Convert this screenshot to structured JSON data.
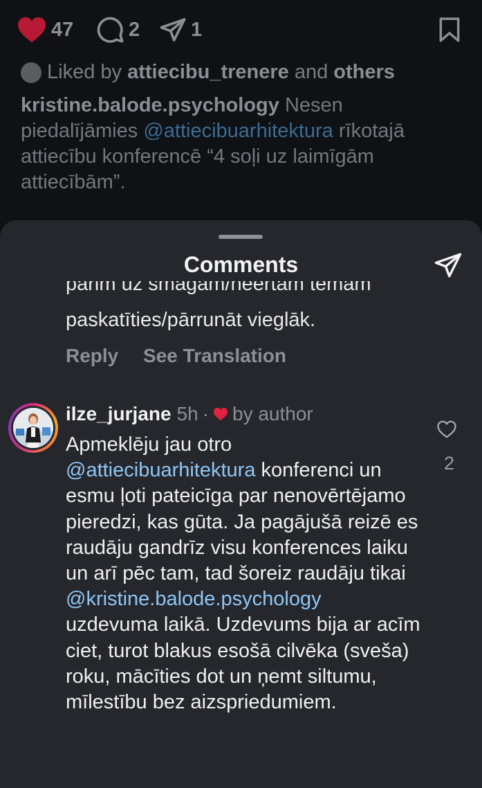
{
  "post": {
    "likes_count": "47",
    "comments_count": "2",
    "shares_count": "1",
    "liked_by_prefix": "Liked by",
    "liked_by_user": "attiecibu_trenere",
    "liked_by_and": "and",
    "liked_by_others": "others",
    "caption_user": "kristine.balode.psychology",
    "caption_part1": "Nesen piedalījāmies",
    "caption_mention": "@attiecibuarhitektura",
    "caption_part2": "rīkotajā attiecību konferencē “4 soļi uz laimīgām attiecībām”."
  },
  "sheet": {
    "title": "Comments",
    "previous_comment_clipped": "pārim uz smagām/neērtām tēmām",
    "previous_comment_last_line": "paskatīties/pārrunāt  vieglāk.",
    "reply_label": "Reply",
    "translation_label": "See Translation"
  },
  "comment": {
    "username": "ilze_jurjane",
    "time": "5h",
    "separator": "·",
    "liked_by_author": "by author",
    "text_1": "Apmeklēju jau otro",
    "mention_1": "@attiecibuarhitektura",
    "text_2": " konferenci un esmu ļoti pateicīga par nenovērtējamo pieredzi, kas gūta. Ja pagājušā reizē es raudāju gandrīz visu konferences laiku un arī pēc tam, tad šoreiz raudāju tikai",
    "mention_2": "@kristine.balode.psychology",
    "text_3": "uzdevuma laikā. Uzdevums bija ar acīm ciet, turot blakus esošā cilvēka (sveša) roku, mācīties dot un ņemt siltumu, mīlestību bez aizspriedumiem.",
    "like_count": "2"
  },
  "icons": {
    "heart": "heart-icon",
    "comment": "comment-icon",
    "send": "send-icon",
    "bookmark": "bookmark-icon",
    "like_outline": "heart-outline-icon"
  },
  "colors": {
    "heart_red": "#e0213f",
    "mention_blue": "#8fc6f5",
    "sheet_bg": "#25272d"
  }
}
